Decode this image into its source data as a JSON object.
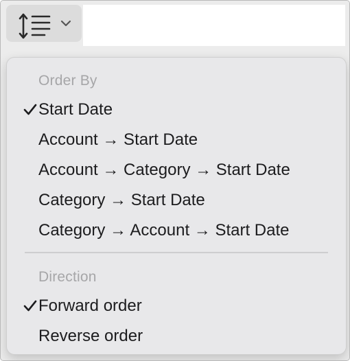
{
  "toolbar": {
    "sort_button_icon": "sort-lines-icon",
    "dropdown_icon": "chevron-down-icon"
  },
  "menu": {
    "order_by": {
      "header": "Order By",
      "items": [
        {
          "label": "Start Date",
          "checked": true
        },
        {
          "label": "Account → Start Date",
          "checked": false
        },
        {
          "label": "Account → Category → Start Date",
          "checked": false
        },
        {
          "label": "Category → Start Date",
          "checked": false
        },
        {
          "label": "Category → Account → Start Date",
          "checked": false
        }
      ]
    },
    "direction": {
      "header": "Direction",
      "items": [
        {
          "label": "Forward order",
          "checked": true
        },
        {
          "label": "Reverse order",
          "checked": false
        }
      ]
    }
  },
  "colors": {
    "menu_background": "#e8e8ea",
    "text": "#1c1c1e",
    "header_text": "#a6a6a8"
  }
}
